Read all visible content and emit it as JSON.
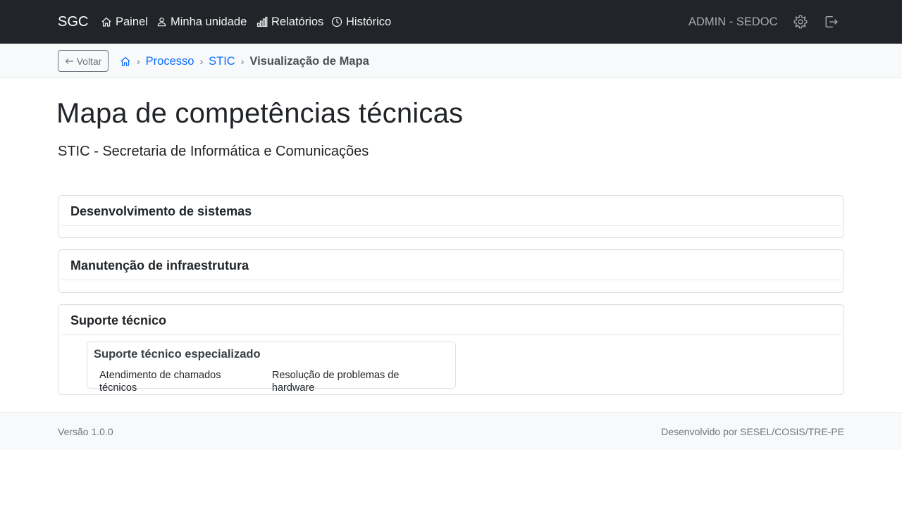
{
  "navbar": {
    "brand": "SGC",
    "items": [
      {
        "label": "Painel",
        "icon": "house-icon"
      },
      {
        "label": "Minha unidade",
        "icon": "person-icon"
      },
      {
        "label": "Relatórios",
        "icon": "bar-chart-icon"
      },
      {
        "label": "Histórico",
        "icon": "clock-icon"
      }
    ],
    "user": "ADMIN - SEDOC",
    "settings_icon": "gear-icon",
    "logout_icon": "logout-icon"
  },
  "breadcrumb": {
    "back_label": "Voltar",
    "home_icon": "house-icon",
    "items": [
      "Processo",
      "STIC"
    ],
    "current": "Visualização de Mapa"
  },
  "page": {
    "title": "Mapa de competências técnicas",
    "subtitle": "STIC - Secretaria de Informática e Comunicações"
  },
  "competencias": [
    {
      "title": "Desenvolvimento de sistemas"
    },
    {
      "title": "Manutenção de infraestrutura"
    },
    {
      "title": "Suporte técnico",
      "atividades": [
        {
          "title": "Suporte técnico especializado",
          "conhecimentos": [
            "Atendimento de chamados técnicos",
            "Resolução de problemas de hardware"
          ]
        }
      ]
    }
  ],
  "footer": {
    "version": "Versão 1.0.0",
    "credits": "Desenvolvido por SESEL/COSIS/TRE-PE"
  },
  "colors": {
    "navbar_bg": "#212529",
    "link": "#0d6efd",
    "muted": "#6c757d"
  }
}
